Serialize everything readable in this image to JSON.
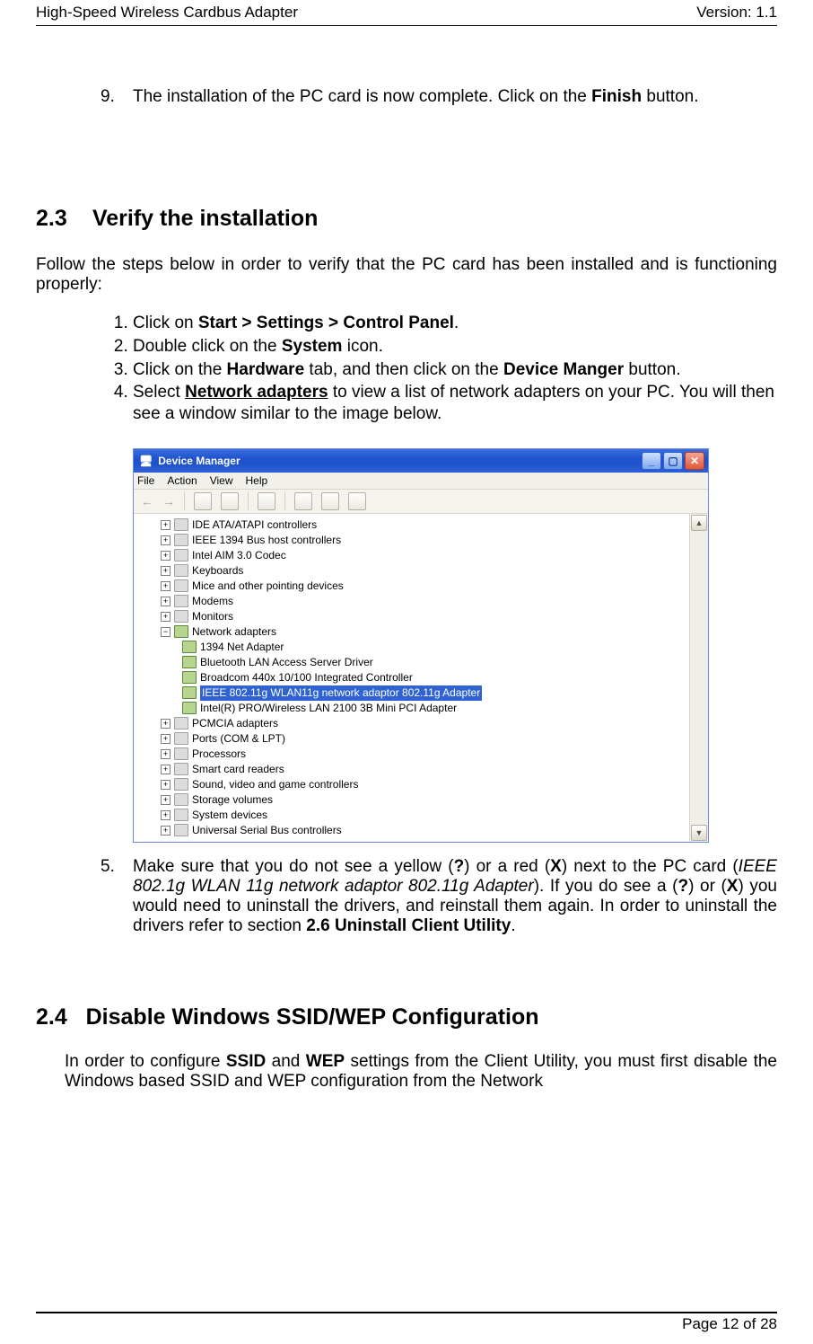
{
  "header": {
    "left": "High-Speed Wireless Cardbus Adapter",
    "right": "Version: 1.1"
  },
  "footer": {
    "text": "Page 12 of 28"
  },
  "step9": {
    "num": "9.",
    "pre": "The installation of the PC card is now complete. Click on the ",
    "bold": "Finish",
    "post": " button."
  },
  "sec23": {
    "no": "2.3",
    "title": "Verify the installation",
    "intro": "Follow the steps below in order to verify that the PC card has been installed and is functioning properly:",
    "s1": {
      "pre": "Click on ",
      "b": "Start > Settings > Control Panel",
      "post": "."
    },
    "s2": {
      "pre": "Double click on the ",
      "b": "System",
      "post": " icon."
    },
    "s3": {
      "pre1": "Click on the ",
      "b1": "Hardware",
      "mid": " tab, and then click on the ",
      "b2": "Device Manger",
      "post": " button."
    },
    "s4": {
      "pre": "Select ",
      "b": "Network adapters",
      "post": " to view a list of network adapters on your PC. You will then see a window similar to the image below."
    }
  },
  "dm": {
    "title": "Device Manager",
    "menu": {
      "file": "File",
      "action": "Action",
      "view": "View",
      "help": "Help"
    },
    "nodes": {
      "ide": "IDE ATA/ATAPI controllers",
      "n1394": "IEEE 1394 Bus host controllers",
      "intelaim": "Intel AIM 3.0 Codec",
      "keyboards": "Keyboards",
      "mice": "Mice and other pointing devices",
      "modems": "Modems",
      "monitors": "Monitors",
      "netadapters": "Network adapters",
      "na1": "1394 Net Adapter",
      "na2": "Bluetooth LAN Access Server Driver",
      "na3": "Broadcom 440x 10/100 Integrated Controller",
      "na4": "IEEE 802.11g WLAN11g network adaptor 802.11g Adapter",
      "na5": "Intel(R) PRO/Wireless LAN 2100 3B Mini PCI Adapter",
      "pcmcia": "PCMCIA adapters",
      "ports": "Ports (COM & LPT)",
      "procs": "Processors",
      "scard": "Smart card readers",
      "sound": "Sound, video and game controllers",
      "storage": "Storage volumes",
      "sysdev": "System devices",
      "usb": "Universal Serial Bus controllers"
    }
  },
  "step5": {
    "num": "5.",
    "t1": "Make sure that you do not see a yellow (",
    "qb": "?",
    "t2": ") or a red (",
    "xb": "X",
    "t3": ") next to the PC card (",
    "italic": "IEEE 802.1g WLAN 11g network adaptor 802.11g Adapter",
    "t4": "). If you do see a (",
    "t5": ") or (",
    "t6": ") you would need to uninstall the drivers, and reinstall them again. In order to uninstall the drivers refer to section ",
    "b_end": "2.6 Uninstall Client Utility",
    "t7": "."
  },
  "sec24": {
    "no": "2.4",
    "title": "Disable Windows SSID/WEP Configuration",
    "p1a": "In order to configure ",
    "b1": "SSID",
    "p1b": " and ",
    "b2": "WEP",
    "p1c": " settings from the Client Utility, you must first disable the Windows based SSID and WEP configuration from the Network"
  }
}
